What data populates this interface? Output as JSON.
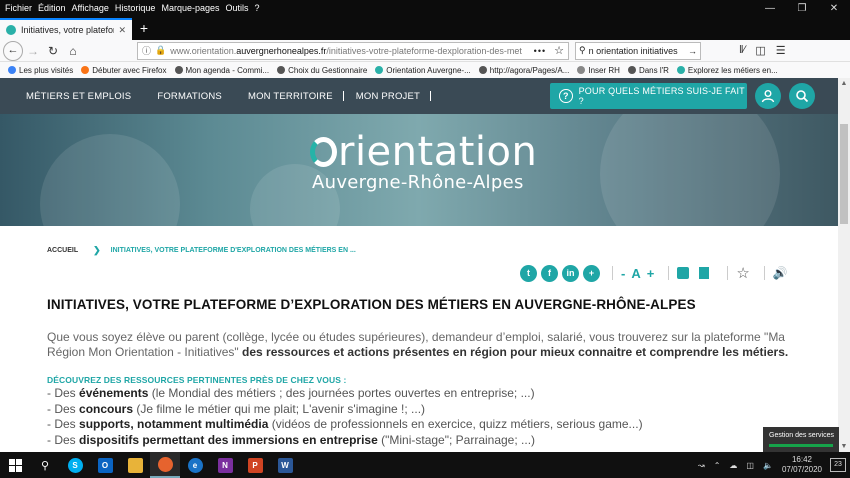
{
  "browser": {
    "menu": [
      "Fichier",
      "Édition",
      "Affichage",
      "Historique",
      "Marque-pages",
      "Outils",
      "?"
    ],
    "tab_title": "Initiatives, votre plateforme d'e",
    "url_prefix": "www.orientation.",
    "url_domain": "auvergnerhonealpes.fr",
    "url_path": "/initiatives-votre-plateforme-dexploration-des-met",
    "search_text": "n orientation initiatives",
    "bookmarks": [
      {
        "label": "Les plus visités",
        "color": "#3b82f6"
      },
      {
        "label": "Débuter avec Firefox",
        "color": "#f97316"
      },
      {
        "label": "Mon agenda - Commi...",
        "color": "#555555"
      },
      {
        "label": "Choix du Gestionnaire",
        "color": "#555555"
      },
      {
        "label": "Orientation Auvergne-...",
        "color": "#2ab0a8"
      },
      {
        "label": "http://agora/Pages/A...",
        "color": "#555555"
      },
      {
        "label": "Inser RH",
        "color": "#888888"
      },
      {
        "label": "Dans l'R",
        "color": "#555555"
      },
      {
        "label": "Explorez les métiers en...",
        "color": "#2ab0a8"
      }
    ]
  },
  "site": {
    "nav": [
      "MÉTIERS ET EMPLOIS",
      "FORMATIONS",
      "MON TERRITOIRE",
      "MON PROJET"
    ],
    "cta": "POUR QUELS MÉTIERS SUIS-JE FAIT ?",
    "logo_line1_rest": "rientation",
    "logo_line2": "Auvergne-Rhône-Alpes",
    "breadcrumb_home": "ACCUEIL",
    "breadcrumb_current": "INITIATIVES, VOTRE PLATEFORME D'EXPLORATION DES MÉTIERS EN ...",
    "text_minus": "-",
    "text_a": "A",
    "text_plus": "+"
  },
  "content": {
    "title": "INITIATIVES, VOTRE PLATEFORME D’EXPLORATION DES MÉTIERS EN AUVERGNE-RHÔNE-ALPES",
    "intro_plain": "Que vous soyez élève ou parent (collège, lycée ou études supérieures), demandeur d’emploi, salarié, vous trouverez sur la plateforme \"Ma Région Mon Orientation - Initiatives\"  ",
    "intro_bold": "des ressources et actions présentes en région pour mieux connaitre et comprendre les métiers.",
    "subheading": "DÉCOUVREZ DES RESSOURCES PERTINENTES PRÈS DE CHEZ VOUS :",
    "items": [
      {
        "pre": "- Des ",
        "bold": "événements",
        "post": " (le Mondial des métiers ; des journées portes ouvertes en entreprise; ...)"
      },
      {
        "pre": "- Des ",
        "bold": "concours",
        "post": " (Je filme le métier qui me plait; L'avenir s'imagine !; ...)"
      },
      {
        "pre": "- Des ",
        "bold": "supports",
        "post2": ", notamment multimédia",
        "post": " (vidéos de professionnels en exercice, quizz métiers, serious game...)"
      },
      {
        "pre": "- Des ",
        "bold": "dispositifs permettant des immersions en entreprise",
        "post": " (\"Mini-stage\"; Parrainage; ...)"
      }
    ]
  },
  "notification": {
    "title": "Gestion des services"
  },
  "taskbar": {
    "time": "16:42",
    "date": "07/07/2020",
    "notif_count": "23"
  }
}
